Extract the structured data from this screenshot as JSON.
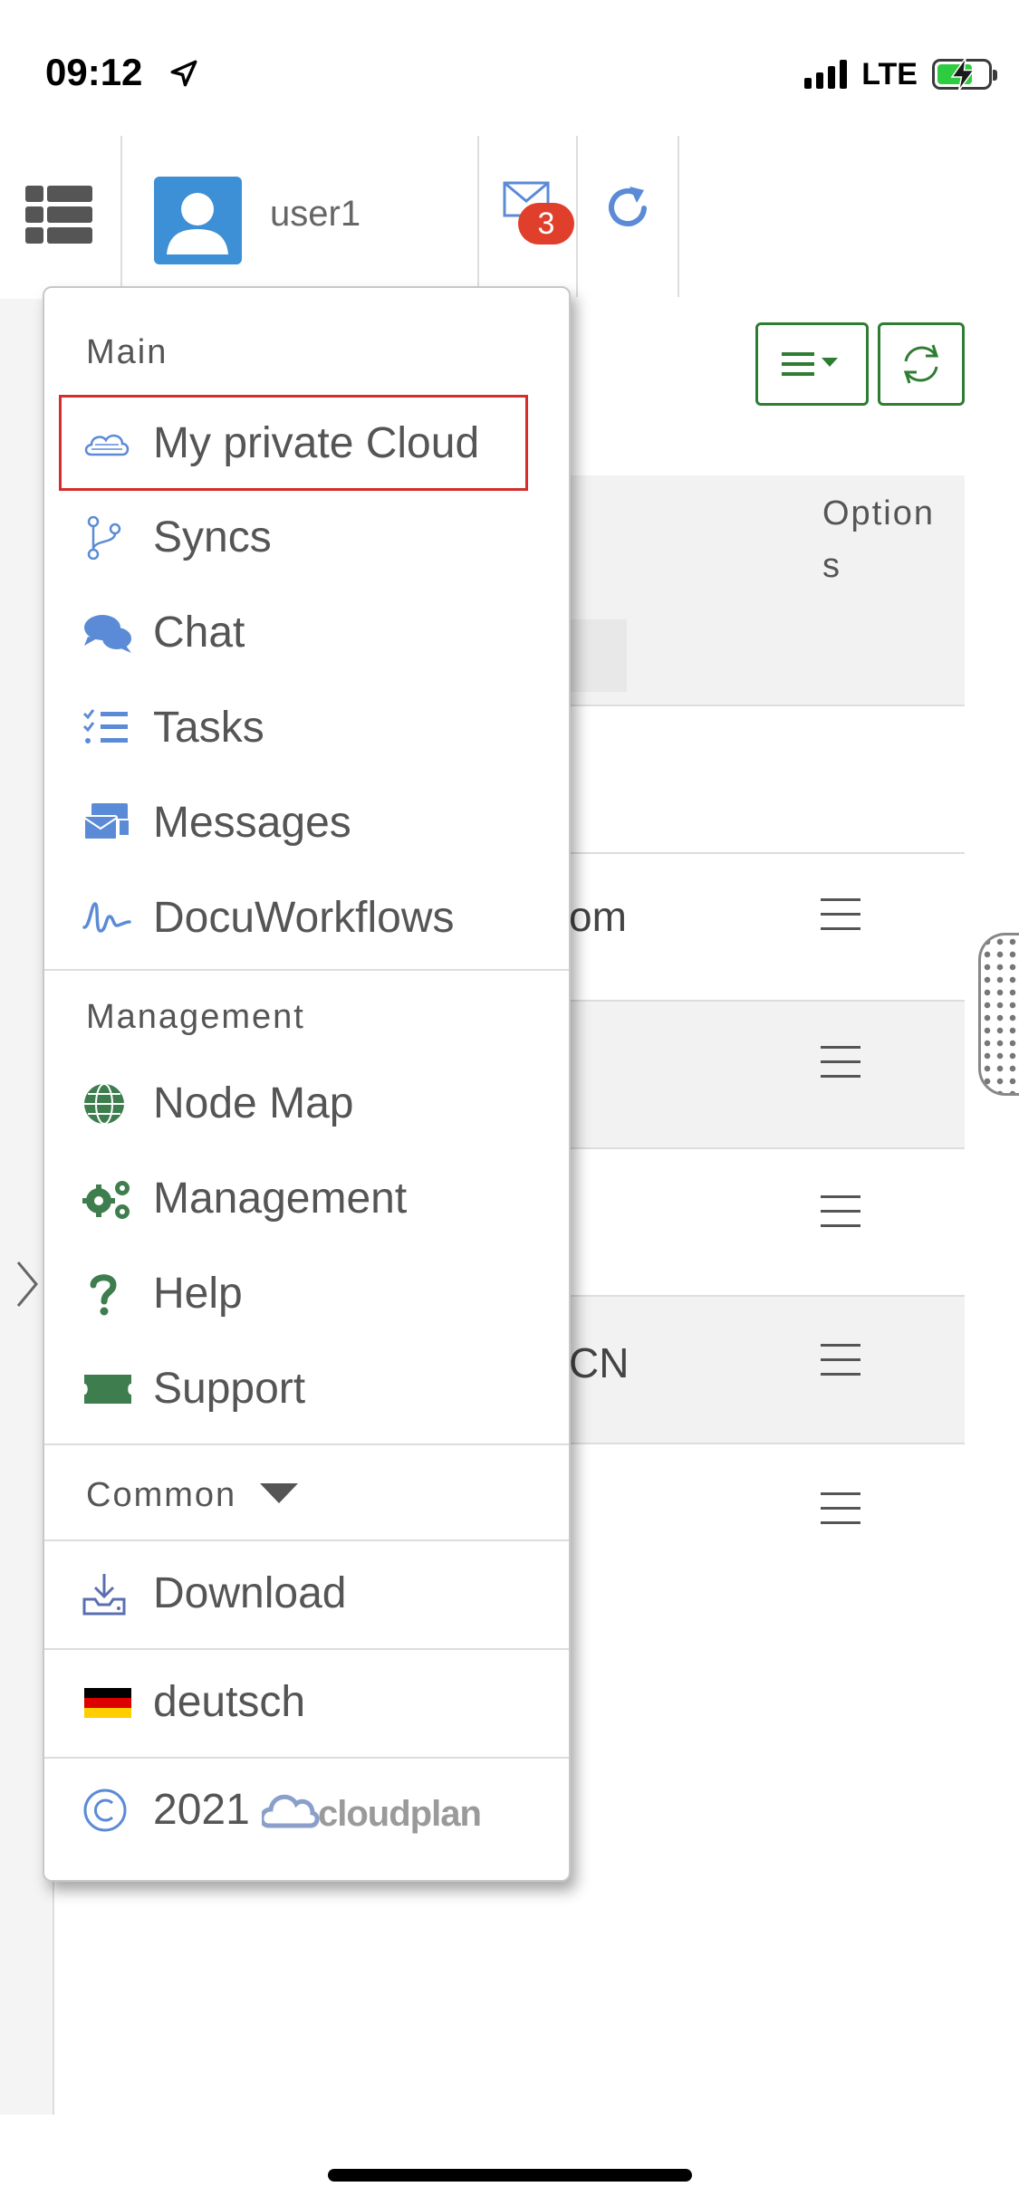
{
  "status_bar": {
    "time": "09:12",
    "network": "LTE"
  },
  "header": {
    "username": "user1",
    "unread_count": "3"
  },
  "table": {
    "options_header": "Options",
    "rows": [
      {
        "text": "om"
      },
      {
        "text": ""
      },
      {
        "text": ""
      },
      {
        "text": "CN"
      },
      {
        "text": ""
      }
    ]
  },
  "menu": {
    "main_title": "Main",
    "main_items": [
      {
        "label": "My private Cloud",
        "icon": "cloud-icon",
        "selected": true
      },
      {
        "label": "Syncs",
        "icon": "branch-icon"
      },
      {
        "label": "Chat",
        "icon": "chat-icon"
      },
      {
        "label": "Tasks",
        "icon": "tasks-icon"
      },
      {
        "label": "Messages",
        "icon": "messages-icon"
      },
      {
        "label": "DocuWorkflows",
        "icon": "signature-icon"
      }
    ],
    "management_title": "Management",
    "management_items": [
      {
        "label": "Node Map",
        "icon": "globe-icon"
      },
      {
        "label": "Management",
        "icon": "gears-icon"
      },
      {
        "label": "Help",
        "icon": "question-icon"
      },
      {
        "label": "Support",
        "icon": "ticket-icon"
      }
    ],
    "common_title": "Common",
    "download_label": "Download",
    "language_label": "deutsch",
    "copyright_year": "2021",
    "brand": "cloudplan"
  },
  "colors": {
    "accent_green": "#2e7d32",
    "icon_blue": "#5b8bd6",
    "icon_green": "#3e7d4e",
    "badge_red": "#e0402b",
    "selection_red": "#d62c2c"
  }
}
